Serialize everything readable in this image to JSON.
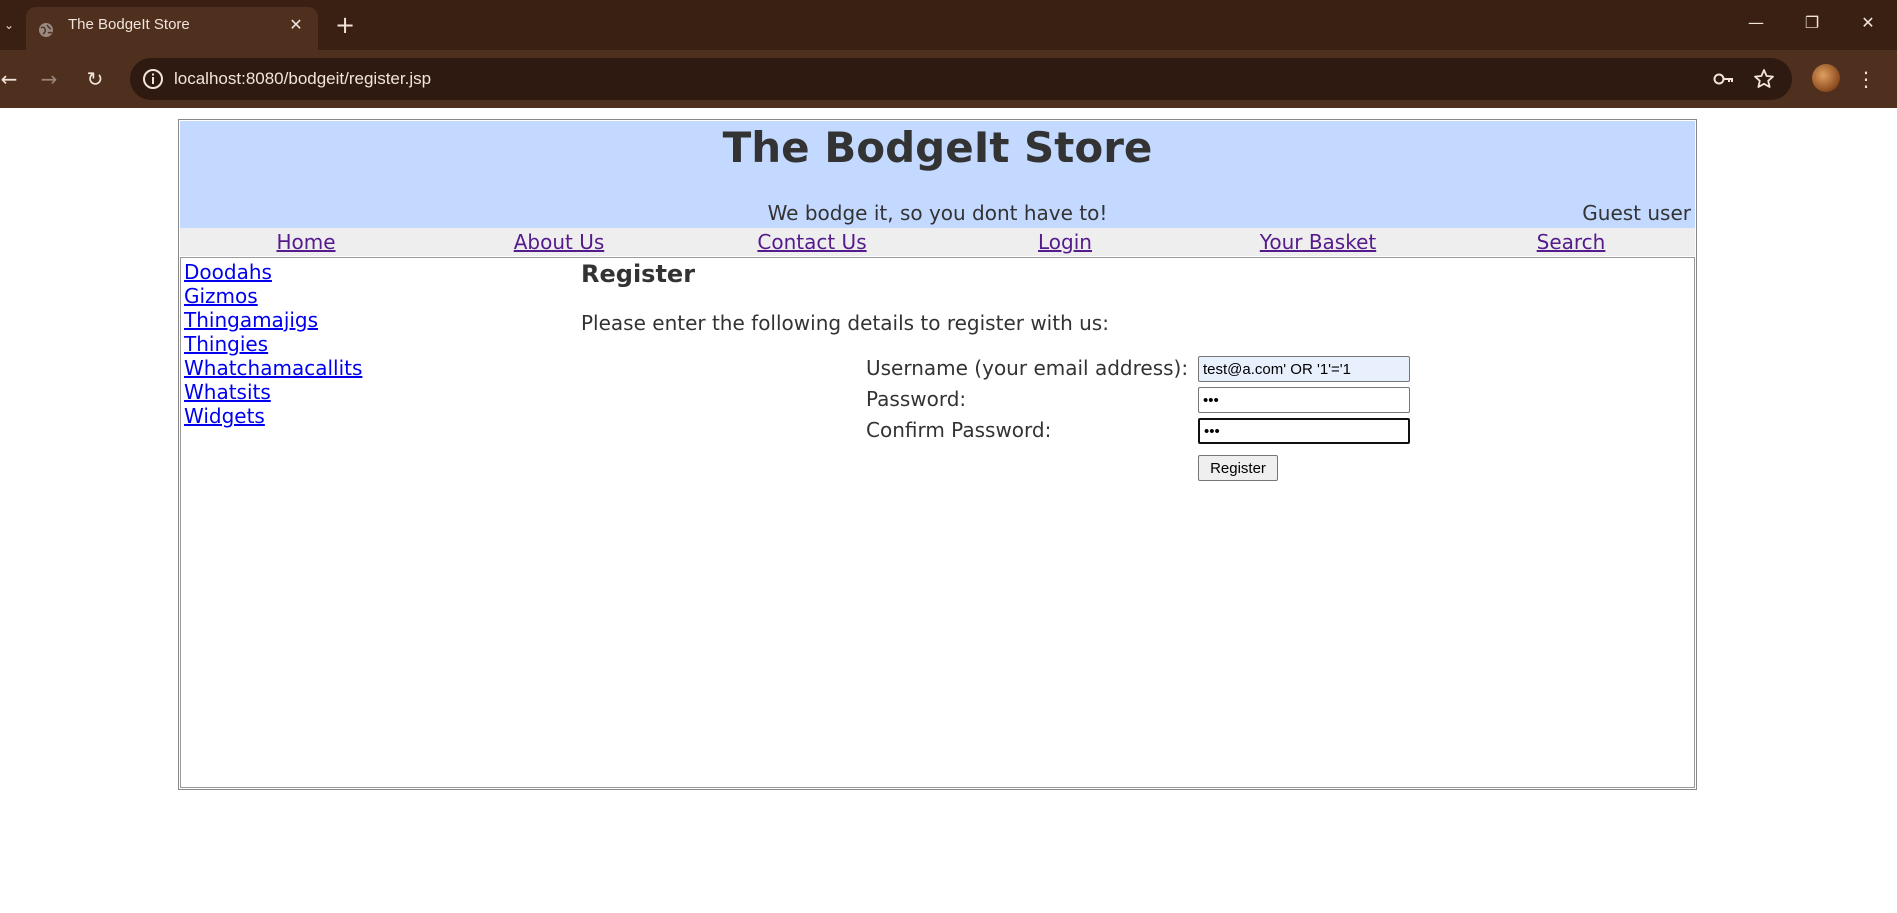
{
  "browser": {
    "tab_title": "The BodgeIt Store",
    "url": "localhost:8080/bodgeit/register.jsp"
  },
  "header": {
    "title": "The BodgeIt Store",
    "tagline": "We bodge it, so you dont have to!",
    "user_status": "Guest user"
  },
  "menu": {
    "items": [
      {
        "label": "Home"
      },
      {
        "label": "About Us"
      },
      {
        "label": "Contact Us"
      },
      {
        "label": "Login"
      },
      {
        "label": "Your Basket"
      },
      {
        "label": "Search"
      }
    ]
  },
  "categories": [
    {
      "label": "Doodahs"
    },
    {
      "label": "Gizmos"
    },
    {
      "label": "Thingamajigs"
    },
    {
      "label": "Thingies"
    },
    {
      "label": "Whatchamacallits"
    },
    {
      "label": "Whatsits"
    },
    {
      "label": "Widgets"
    }
  ],
  "register": {
    "title": "Register",
    "intro": "Please enter the following details to register with us:",
    "username_label": "Username (your email address):",
    "username_value": "test@a.com' OR '1'='1",
    "password_label": "Password:",
    "password_value": "•••",
    "confirm_label": "Confirm Password:",
    "confirm_value": "•••",
    "button_label": "Register"
  },
  "colors": {
    "header_bg": "#c3d9ff",
    "menu_bg": "#eeeeee",
    "visited_link": "#551a8b",
    "link": "#0000ee",
    "chrome_bg": "#3a2012"
  },
  "icons": [
    "tab-list-icon",
    "globe-favicon-icon",
    "close-icon",
    "plus-icon",
    "minimize-icon",
    "restore-icon",
    "window-close-icon",
    "back-arrow-icon",
    "forward-arrow-icon",
    "reload-icon",
    "site-info-icon",
    "key-icon",
    "star-icon",
    "more-menu-icon"
  ]
}
